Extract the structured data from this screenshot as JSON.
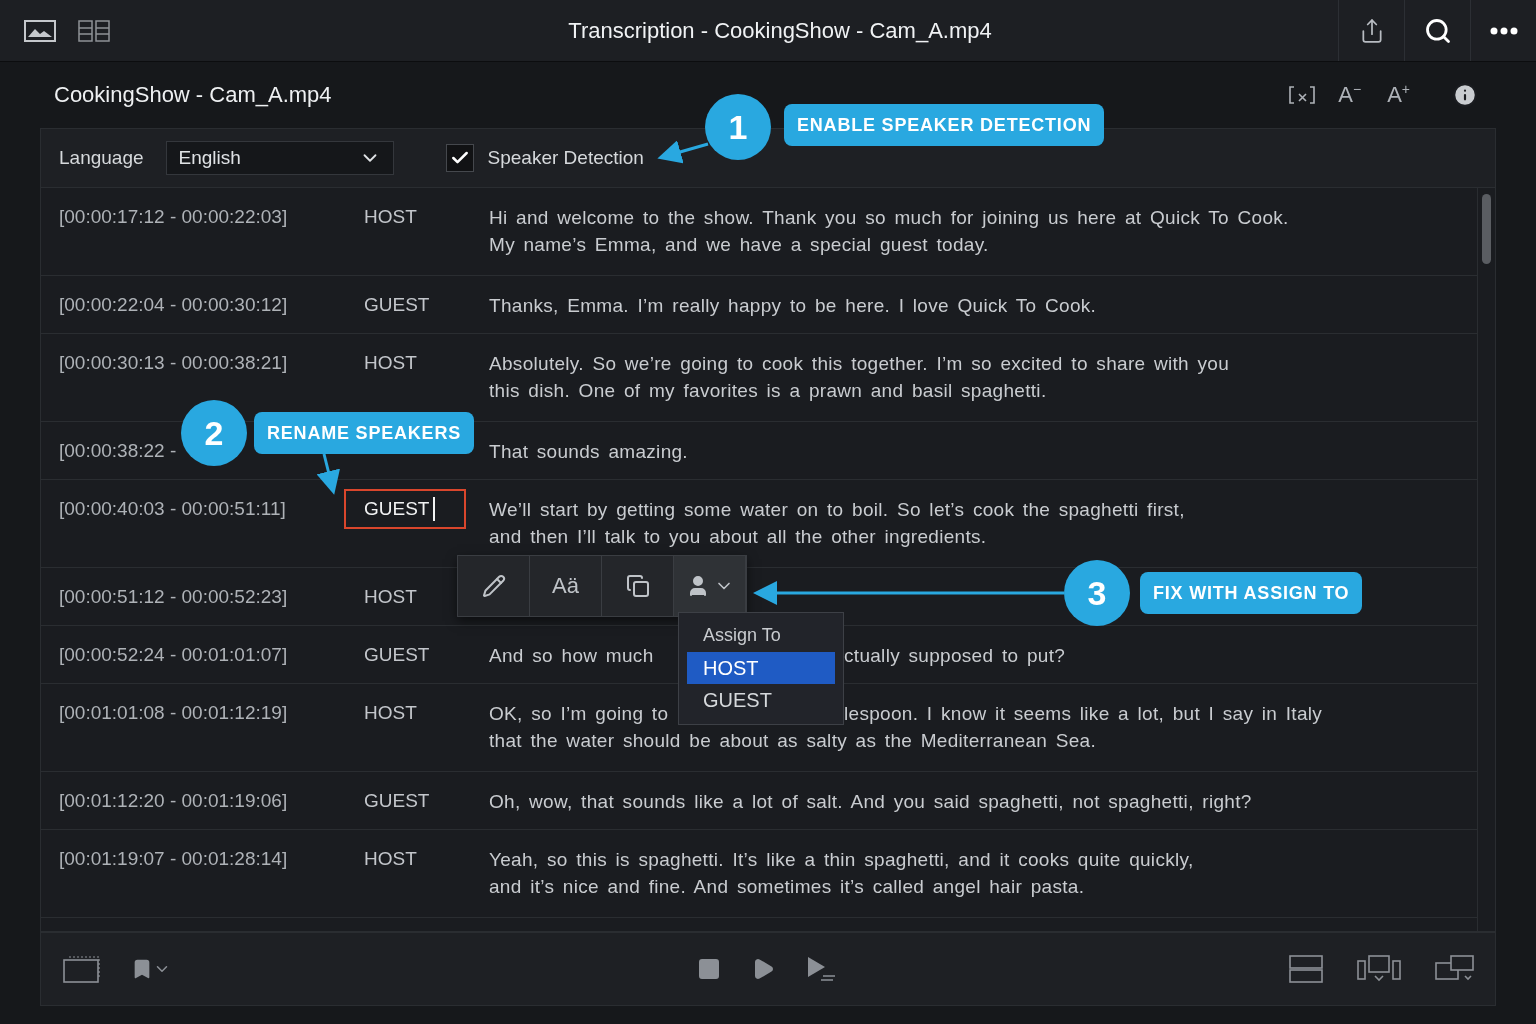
{
  "window": {
    "title": "Transcription - CookingShow - Cam_A.mp4"
  },
  "header": {
    "title": "CookingShow - Cam_A.mp4",
    "font_smaller": "A$^{−}$",
    "font_larger": "A$^{+}$"
  },
  "options": {
    "language_label": "Language",
    "language_value": "English",
    "speaker_detection": {
      "label": "Speaker Detection",
      "checked": true
    }
  },
  "rows": [
    {
      "time": "[00:00:17:12 - 00:00:22:03]",
      "speaker": "HOST",
      "lines": [
        [
          "Hi and welcome to the show. Thank you so much for joining us here at Quick To Cook."
        ],
        [
          "My name’s Emma, and we have a special guest today."
        ]
      ],
      "editing": false
    },
    {
      "time": "[00:00:22:04 - 00:00:30:12]",
      "speaker": "GUEST",
      "lines": [
        [
          "Thanks, Emma. I’m really happy to be here. I love Quick To Cook."
        ]
      ],
      "editing": false
    },
    {
      "time": "[00:00:30:13 - 00:00:38:21]",
      "speaker": "HOST",
      "lines": [
        [
          "Absolutely. So we’re going to cook this together. I’m so excited to share with you"
        ],
        [
          "this dish. One of my favorites is a prawn and basil spaghetti."
        ]
      ],
      "editing": false
    },
    {
      "time": "[00:00:38:22 -",
      "speaker": "",
      "lines": [
        [
          "That sounds amazing."
        ]
      ],
      "editing": false
    },
    {
      "time": "[00:00:40:03 - 00:00:51:11]",
      "speaker": "GUEST",
      "lines": [
        [
          "We’ll start by getting some water on to boil. So let’s cook the spaghetti first,"
        ],
        [
          "and then I’ll talk to you about all the other ingredients."
        ]
      ],
      "editing": true
    },
    {
      "time": "[00:00:51:12 - 00:00:52:23]",
      "speaker": "HOST",
      "lines": [],
      "editing": false
    },
    {
      "time": "[00:00:52:24 - 00:01:01:07]",
      "speaker": "GUEST",
      "lines": [
        [
          "And so how much",
          "ctually supposed to put?"
        ]
      ],
      "editing": false
    },
    {
      "time": "[00:01:01:08 - 00:01:12:19]",
      "speaker": "HOST",
      "lines": [
        [
          "OK, so I’m going to",
          "lespoon. I know it seems like a lot, but I say in Italy"
        ],
        [
          "that the water should be about as salty as the Mediterranean Sea."
        ]
      ],
      "editing": false
    },
    {
      "time": "[00:01:12:20 - 00:01:19:06]",
      "speaker": "GUEST",
      "lines": [
        [
          "Oh, wow, that sounds like a lot of salt. And you said spaghetti, not spaghetti, right?"
        ]
      ],
      "editing": false
    },
    {
      "time": "[00:01:19:07 - 00:01:28:14]",
      "speaker": "HOST",
      "lines": [
        [
          "Yeah, so this is spaghetti. It’s like a thin spaghetti, and it cooks quite quickly,"
        ],
        [
          "and it’s nice and fine. And sometimes it’s called angel hair pasta."
        ]
      ],
      "editing": false
    }
  ],
  "edit_toolbar": {
    "case_label": "Aä"
  },
  "assign_menu": {
    "title": "Assign To",
    "options": [
      {
        "label": "HOST",
        "selected": true
      },
      {
        "label": "GUEST",
        "selected": false
      }
    ]
  },
  "callouts": [
    {
      "number": "1",
      "label": "ENABLE SPEAKER DETECTION"
    },
    {
      "number": "2",
      "label": "RENAME SPEAKERS"
    },
    {
      "number": "3",
      "label": "FIX WITH ASSIGN TO"
    }
  ]
}
